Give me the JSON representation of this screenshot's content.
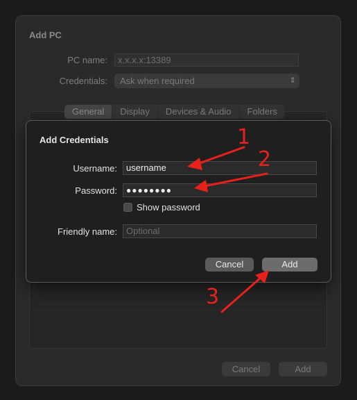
{
  "background_sheet": {
    "title": "Add PC",
    "pc_name_label": "PC name:",
    "pc_name_value": "x.x.x.x:13389",
    "credentials_label": "Credentials:",
    "credentials_value": "Ask when required",
    "tabs": [
      {
        "label": "General",
        "active": true
      },
      {
        "label": "Display",
        "active": false
      },
      {
        "label": "Devices & Audio",
        "active": false
      },
      {
        "label": "Folders",
        "active": false
      }
    ],
    "cancel_label": "Cancel",
    "add_label": "Add"
  },
  "dialog": {
    "title": "Add Credentials",
    "username_label": "Username:",
    "username_value": "username",
    "password_label": "Password:",
    "password_value": "●●●●●●●●",
    "show_password_label": "Show password",
    "show_password_checked": false,
    "friendly_name_label": "Friendly name:",
    "friendly_name_placeholder": "Optional",
    "cancel_label": "Cancel",
    "add_label": "Add"
  },
  "annotations": {
    "step_1": "1",
    "step_2": "2",
    "step_3": "3",
    "color": "#e8211c"
  }
}
